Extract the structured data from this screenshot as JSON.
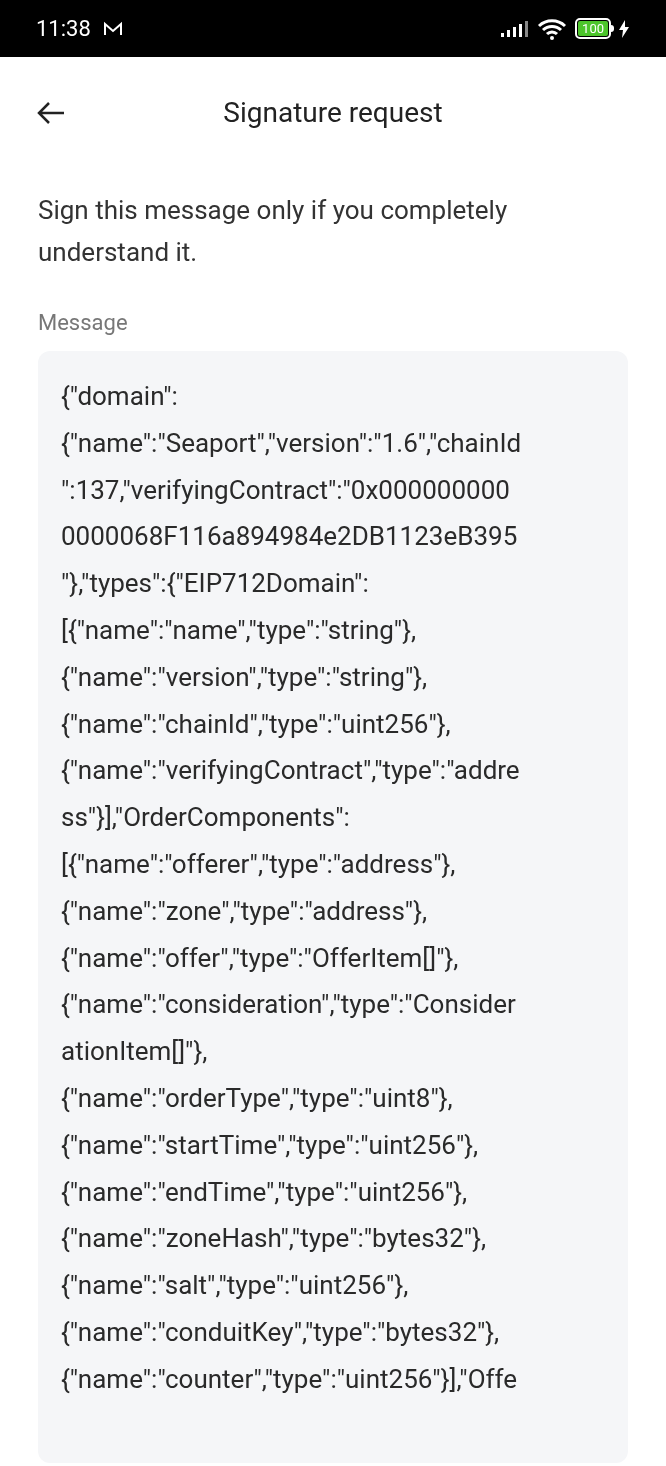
{
  "status_bar": {
    "time": "11:38",
    "battery": "100"
  },
  "header": {
    "title": "Signature request"
  },
  "notice": "Sign this message only if you completely understand it.",
  "message": {
    "label": "Message",
    "lines": [
      "{\"domain\":",
      "{\"name\":\"Seaport\",\"version\":\"1.6\",\"chainId",
      "\":137,\"verifyingContract\":\"0x000000000",
      "0000068F116a894984e2DB1123eB395",
      "\"},\"types\":{\"EIP712Domain\":",
      "[{\"name\":\"name\",\"type\":\"string\"},",
      "{\"name\":\"version\",\"type\":\"string\"},",
      "{\"name\":\"chainId\",\"type\":\"uint256\"},",
      "{\"name\":\"verifyingContract\",\"type\":\"addre",
      "ss\"}],\"OrderComponents\":",
      "[{\"name\":\"offerer\",\"type\":\"address\"},",
      "{\"name\":\"zone\",\"type\":\"address\"},",
      "{\"name\":\"offer\",\"type\":\"OfferItem[]\"},",
      "{\"name\":\"consideration\",\"type\":\"Consider",
      "ationItem[]\"},",
      "{\"name\":\"orderType\",\"type\":\"uint8\"},",
      "{\"name\":\"startTime\",\"type\":\"uint256\"},",
      "{\"name\":\"endTime\",\"type\":\"uint256\"},",
      "{\"name\":\"zoneHash\",\"type\":\"bytes32\"},",
      "{\"name\":\"salt\",\"type\":\"uint256\"},",
      "{\"name\":\"conduitKey\",\"type\":\"bytes32\"},",
      "{\"name\":\"counter\",\"type\":\"uint256\"}],\"Offe"
    ]
  }
}
